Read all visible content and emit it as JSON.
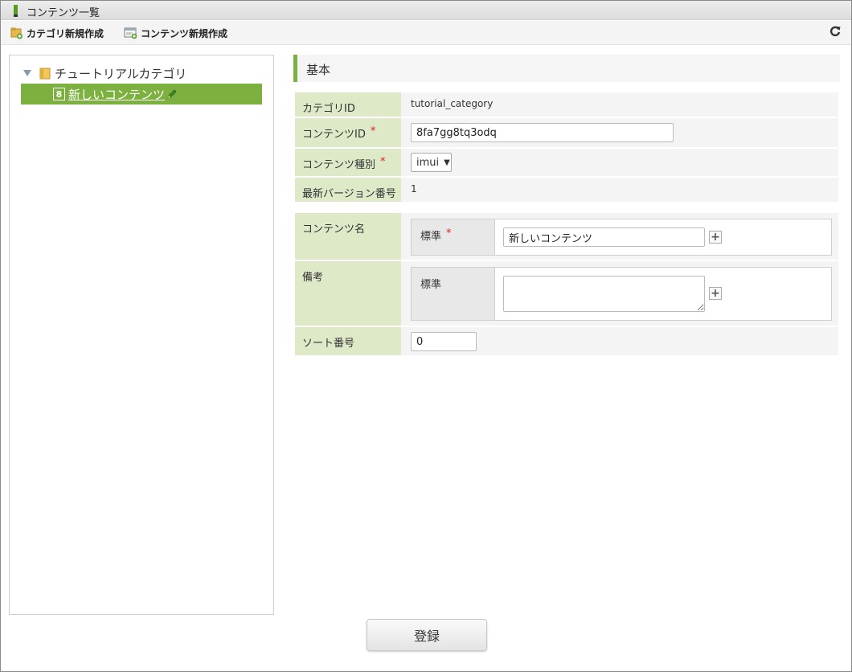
{
  "window": {
    "title": "コンテンツ一覧"
  },
  "toolbar": {
    "new_category_label": "カテゴリ新規作成",
    "new_content_label": "コンテンツ新規作成",
    "refresh_icon": "refresh-icon"
  },
  "tree": {
    "root_label": "チュートリアルカテゴリ",
    "selected_node_badge": "8",
    "selected_node_label": "新しいコンテンツ"
  },
  "section": {
    "title": "基本"
  },
  "form": {
    "category_id": {
      "label": "カテゴリID",
      "value": "tutorial_category"
    },
    "content_id": {
      "label": "コンテンツID",
      "required_mark": "*",
      "value": "8fa7gg8tq3odq"
    },
    "content_type": {
      "label": "コンテンツ種別",
      "required_mark": "*",
      "value": "imui"
    },
    "latest_version": {
      "label": "最新バージョン番号",
      "value": "1"
    },
    "content_name": {
      "label": "コンテンツ名",
      "locale_label": "標準",
      "required_mark": "*",
      "value": "新しいコンテンツ"
    },
    "remarks": {
      "label": "備考",
      "locale_label": "標準",
      "value": ""
    },
    "sort_number": {
      "label": "ソート番号",
      "value": "0"
    }
  },
  "actions": {
    "register_label": "登録"
  },
  "colors": {
    "accent": "#7db13f",
    "label_bg": "#dde9c7",
    "required": "#e02020"
  }
}
